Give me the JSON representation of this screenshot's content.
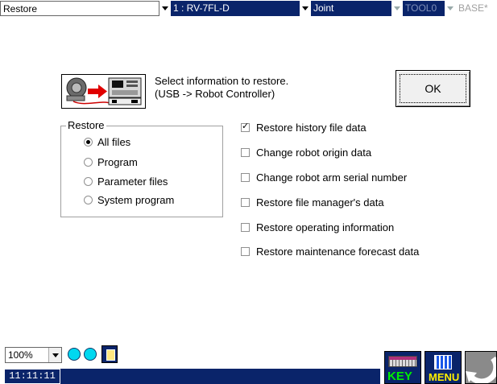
{
  "window": {
    "title": "Restore"
  },
  "toolbar": {
    "robot": "1 : RV-7FL-D",
    "coordinate": "Joint",
    "tool": "TOOL0",
    "base": "BASE*"
  },
  "info": {
    "line1": "Select information to restore.",
    "line2": "(USB -> Robot Controller)"
  },
  "ok_label": "OK",
  "restore_group": {
    "title": "Restore",
    "options": [
      {
        "label": "All files",
        "selected": true
      },
      {
        "label": "Program",
        "selected": false
      },
      {
        "label": "Parameter files",
        "selected": false
      },
      {
        "label": "System program",
        "selected": false
      }
    ]
  },
  "checks": [
    {
      "label": "Restore history file data",
      "checked": true
    },
    {
      "label": "Change robot origin data",
      "checked": false
    },
    {
      "label": "Change robot arm serial number",
      "checked": false
    },
    {
      "label": "Restore file manager's data",
      "checked": false
    },
    {
      "label": "Restore operating information",
      "checked": false
    },
    {
      "label": "Restore maintenance forecast data",
      "checked": false
    }
  ],
  "zoom": "100%",
  "clock": "11:11:11",
  "buttons": {
    "key": "KEY",
    "menu": "MENU"
  },
  "colors": {
    "accent": "#0a246a",
    "lamp": "#00d8f0"
  },
  "icons": [
    "robot-transfer-icon",
    "lock-icon",
    "keyboard-icon",
    "menu-icon",
    "back-arrow-icon"
  ]
}
